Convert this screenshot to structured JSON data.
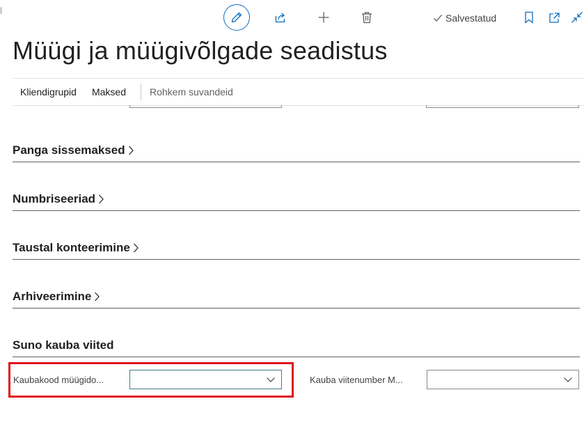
{
  "toolbar": {
    "icons": [
      "edit-icon",
      "share-icon",
      "plus-icon",
      "delete-icon",
      "bookmark-icon",
      "popout-icon",
      "collapse-icon"
    ],
    "saved_label": "Salvestatud"
  },
  "page": {
    "title": "Müügi ja müügivõlgade seadistus"
  },
  "actionbar": {
    "items": [
      "Kliendigrupid",
      "Maksed"
    ],
    "more_label": "Rohkem suvandeid"
  },
  "sections": [
    {
      "title": "Panga sissemaksed",
      "collapsed": true
    },
    {
      "title": "Numbriseeriad",
      "collapsed": true
    },
    {
      "title": "Taustal konteerimine",
      "collapsed": true
    },
    {
      "title": "Arhiveerimine",
      "collapsed": true
    },
    {
      "title": "Suno kauba viited",
      "collapsed": false
    }
  ],
  "fields": {
    "item_code_label": "Kaubakood müügido...",
    "item_code_value": "",
    "item_ref_label": "Kauba viitenumber M...",
    "item_ref_value": ""
  },
  "colors": {
    "accent": "#0f6cbd",
    "highlight": "#e0141e"
  }
}
